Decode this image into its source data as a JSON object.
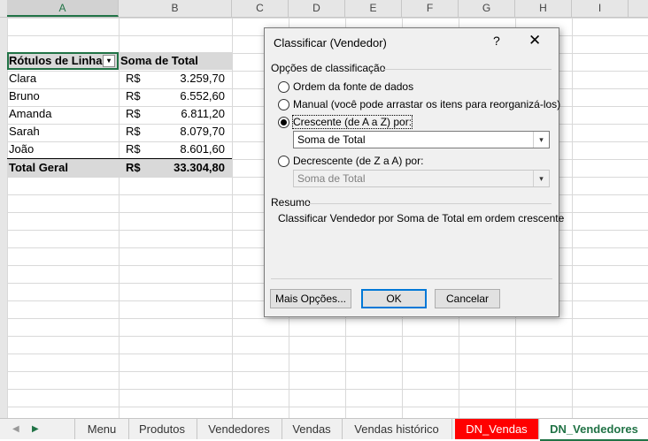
{
  "columns": [
    "A",
    "B",
    "C",
    "D",
    "E",
    "F",
    "G",
    "H",
    "I"
  ],
  "pivot": {
    "header": {
      "label": "Rótulos de Linha",
      "value": "Soma de Total"
    },
    "rows": [
      {
        "name": "Clara",
        "currency": "R$",
        "amount": "3.259,70"
      },
      {
        "name": "Bruno",
        "currency": "R$",
        "amount": "6.552,60"
      },
      {
        "name": "Amanda",
        "currency": "R$",
        "amount": "6.811,20"
      },
      {
        "name": "Sarah",
        "currency": "R$",
        "amount": "8.079,70"
      },
      {
        "name": "João",
        "currency": "R$",
        "amount": "8.601,60"
      }
    ],
    "total": {
      "label": "Total Geral",
      "currency": "R$",
      "amount": "33.304,80"
    }
  },
  "dialog": {
    "title": "Classificar (Vendedor)",
    "help": "?",
    "close": "✕",
    "options_group": "Opções de classificação",
    "radio_data_source": "Ordem da fonte de dados",
    "radio_manual": "Manual (você pode arrastar os itens para reorganizá-los)",
    "radio_ascending": "Crescente (de A a Z) por:",
    "ascending_field": "Soma de Total",
    "radio_descending": "Decrescente (de Z a A) por:",
    "descending_field": "Soma de Total",
    "summary_group": "Resumo",
    "summary_text": "Classificar Vendedor por Soma de Total em ordem crescente",
    "more_options": "Mais Opções...",
    "ok": "OK",
    "cancel": "Cancelar"
  },
  "sheet_tabs": [
    "Menu",
    "Produtos",
    "Vendedores",
    "Vendas",
    "Vendas histórico",
    "DN_Vendas",
    "DN_Vendedores"
  ],
  "colors": {
    "accent": "#217346",
    "tab_red": "#ff0000",
    "dialog_focus": "#0078d7"
  }
}
